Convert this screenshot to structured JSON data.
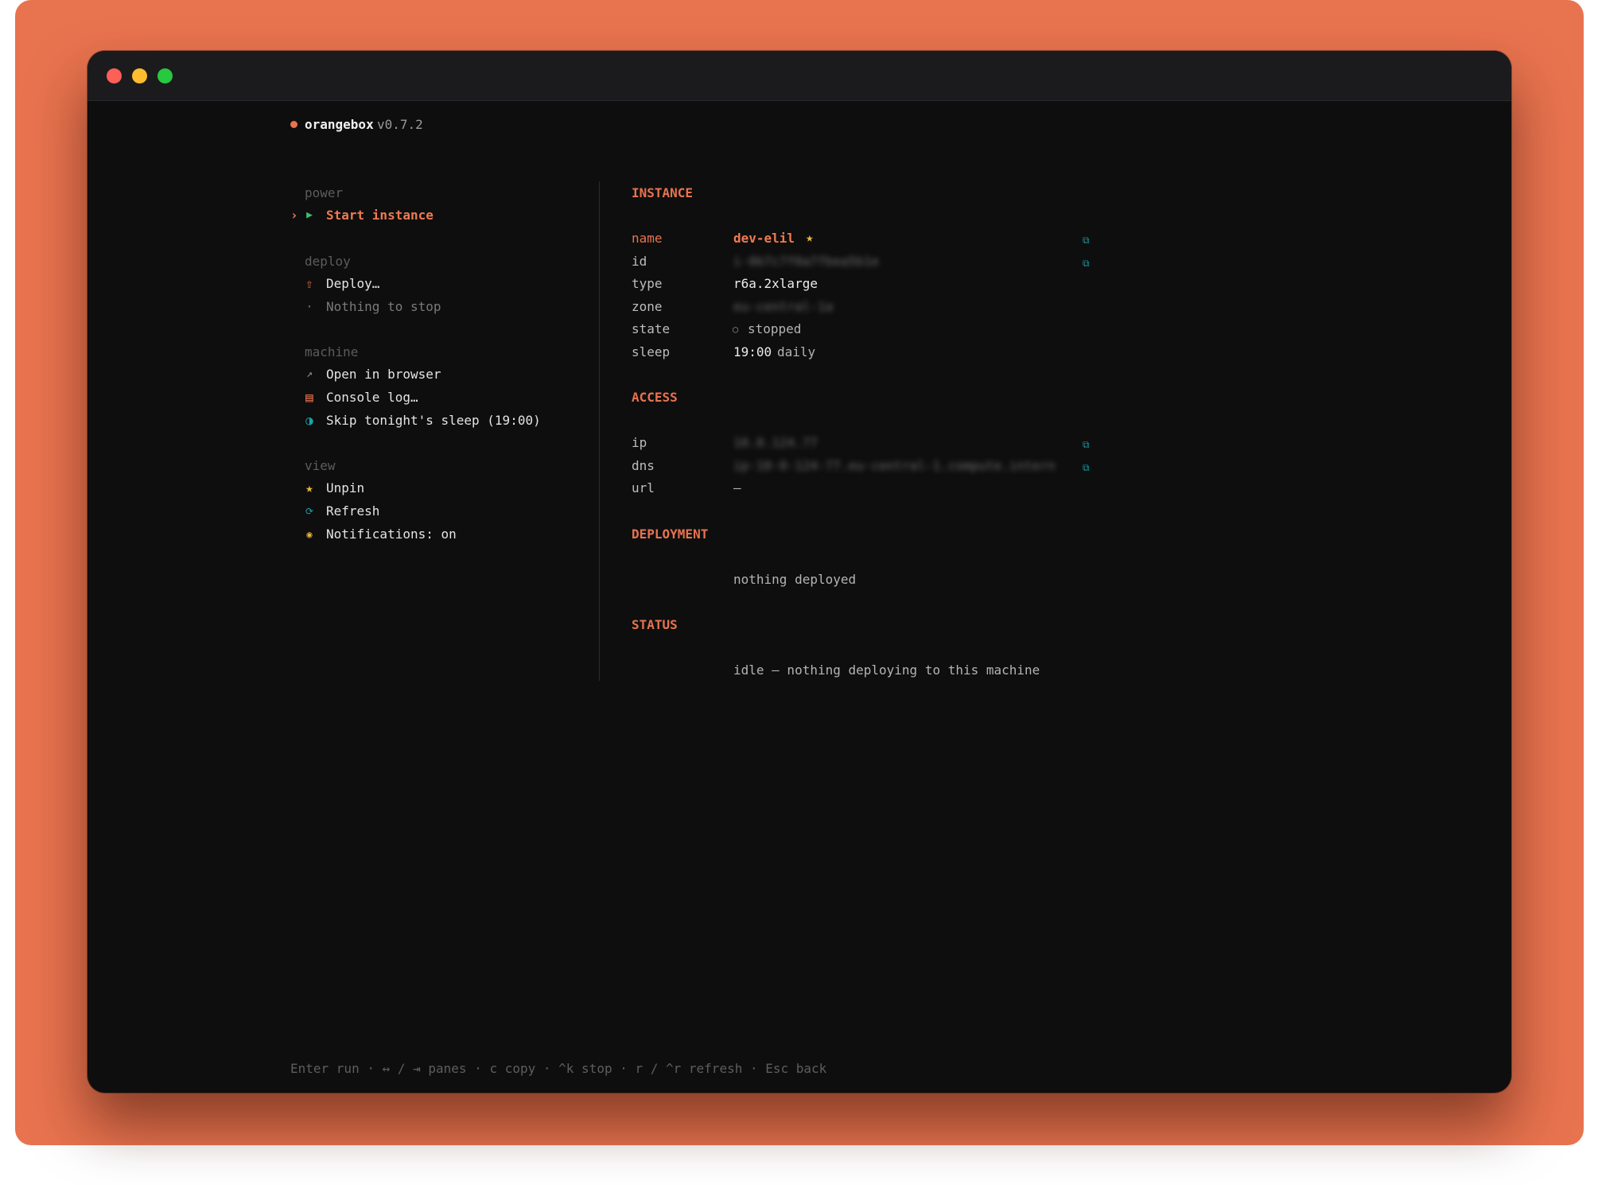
{
  "app": {
    "name": "orangebox",
    "version": "v0.7.2"
  },
  "menu": {
    "caret": "›",
    "groups": [
      {
        "heading": "power",
        "items": [
          {
            "icon": "play-icon",
            "glyph": "▶",
            "label": "Start instance",
            "selected": true
          }
        ]
      },
      {
        "heading": "deploy",
        "items": [
          {
            "icon": "upload-icon",
            "glyph": "⇧",
            "label": "Deploy…"
          },
          {
            "icon": "dot-icon",
            "glyph": "·",
            "label": "Nothing to stop",
            "disabled": true
          }
        ]
      },
      {
        "heading": "machine",
        "items": [
          {
            "icon": "external-link-icon",
            "glyph": "↗",
            "label": "Open in browser"
          },
          {
            "icon": "log-icon",
            "glyph": "▤",
            "label": "Console log…"
          },
          {
            "icon": "half-moon-icon",
            "glyph": "◑",
            "label": "Skip tonight's sleep (19:00)"
          }
        ]
      },
      {
        "heading": "view",
        "items": [
          {
            "icon": "star-icon",
            "glyph": "★",
            "label": "Unpin"
          },
          {
            "icon": "refresh-icon",
            "glyph": "⟳",
            "label": "Refresh"
          },
          {
            "icon": "bell-icon",
            "glyph": "◉",
            "label": "Notifications: on"
          }
        ]
      }
    ]
  },
  "instance": {
    "heading": "INSTANCE",
    "name_key": "name",
    "name_value": "dev-elil",
    "name_star": "★",
    "id_key": "id",
    "id_value": "i-0b7c7f0a7fbea5b1e",
    "type_key": "type",
    "type_value": "r6a.2xlarge",
    "zone_key": "zone",
    "zone_value": "eu-central-1a",
    "state_key": "state",
    "state_glyph": "○",
    "state_value": "stopped",
    "sleep_key": "sleep",
    "sleep_time": "19:00",
    "sleep_freq": "daily"
  },
  "access": {
    "heading": "ACCESS",
    "ip_key": "ip",
    "ip_value": "10.0.124.77",
    "dns_key": "dns",
    "dns_value": "ip-10-0-124-77.eu-central-1.compute.internal",
    "url_key": "url",
    "url_value": "—"
  },
  "deployment": {
    "heading": "DEPLOYMENT",
    "text": "nothing deployed"
  },
  "status": {
    "heading": "STATUS",
    "text": "idle — nothing deploying to this machine"
  },
  "copy_glyph": "⧉",
  "footer": "Enter run · ↔ / ⇥ panes · c copy · ^k stop · r / ^r refresh · Esc back",
  "colors": {
    "accent": "#e8734f",
    "background": "#0e0e0e",
    "play_green": "#3fbf6f",
    "star_yellow": "#e6b63b",
    "cyan": "#1aa3a8"
  }
}
